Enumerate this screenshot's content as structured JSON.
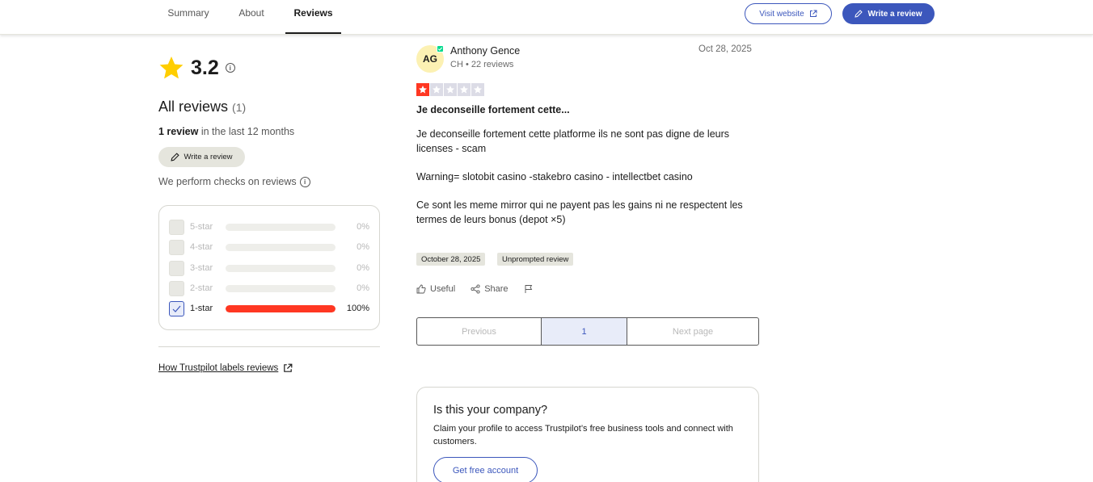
{
  "nav": {
    "tabs": [
      {
        "label": "Summary"
      },
      {
        "label": "About"
      },
      {
        "label": "Reviews",
        "active": true
      }
    ],
    "visit_website": "Visit website",
    "write_review": "Write a review"
  },
  "summary": {
    "rating": "3.2",
    "all_reviews_label": "All reviews",
    "all_reviews_count": "(1)",
    "last12_count": "1 review",
    "last12_suffix": " in the last 12 months",
    "write_review": "Write a review",
    "checks_text": "We perform checks on reviews",
    "filters": [
      {
        "label": "5-star",
        "percent": "0%",
        "fill": 0,
        "checked": false
      },
      {
        "label": "4-star",
        "percent": "0%",
        "fill": 0,
        "checked": false
      },
      {
        "label": "3-star",
        "percent": "0%",
        "fill": 0,
        "checked": false
      },
      {
        "label": "2-star",
        "percent": "0%",
        "fill": 0,
        "checked": false
      },
      {
        "label": "1-star",
        "percent": "100%",
        "fill": 100,
        "checked": true
      }
    ],
    "labels_link": "How Trustpilot labels reviews"
  },
  "review": {
    "initials": "AG",
    "author": "Anthony Gence",
    "meta": "CH • 22 reviews",
    "date": "Oct 28, 2025",
    "stars": 1,
    "title": "Je deconseille fortement cette...",
    "body": [
      "Je deconseille fortement cette platforme ils ne sont pas digne de leurs licenses - scam",
      "Warning= slotobit casino -stakebro casino - intellectbet casino",
      "Ce sont les meme mirror qui ne payent pas les gains ni ne respectent les termes de leurs bonus (depot ×5)"
    ],
    "chip_date": "October 28, 2025",
    "chip_type": "Unprompted review",
    "useful": "Useful",
    "share": "Share"
  },
  "pager": {
    "previous": "Previous",
    "current": "1",
    "next": "Next page"
  },
  "company": {
    "title": "Is this your company?",
    "desc": "Claim your profile to access Trustpilot’s free business tools and connect with customers.",
    "button": "Get free account"
  },
  "colors": {
    "accent": "#3c57bc",
    "star_red": "#ff3722",
    "rating_star": "#ffce00",
    "verified": "#04da8d"
  }
}
